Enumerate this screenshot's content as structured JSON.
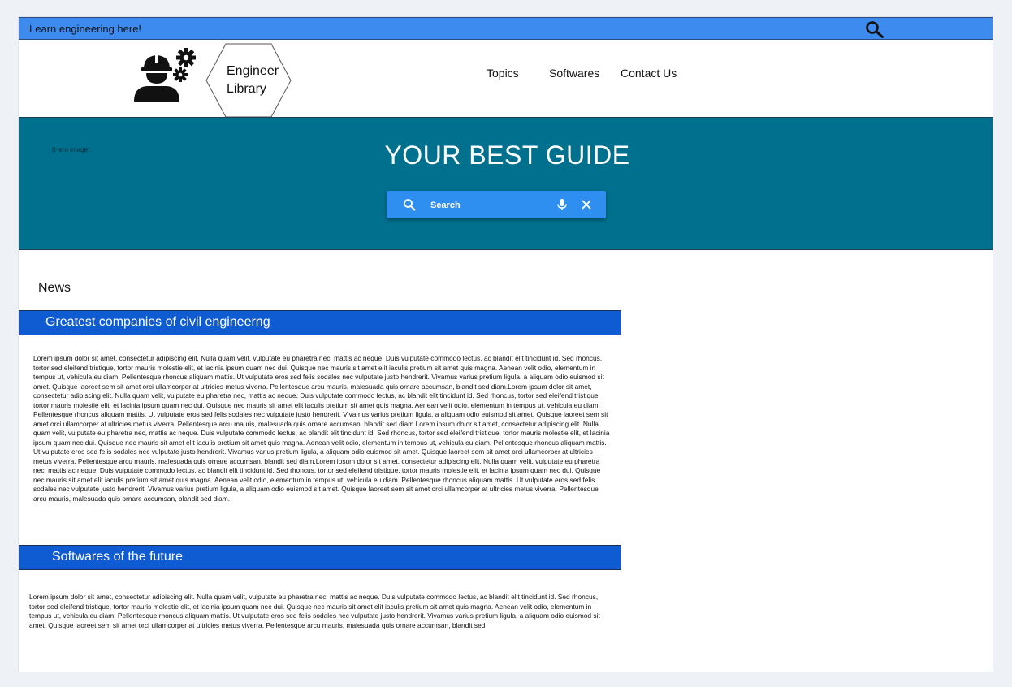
{
  "topbar": {
    "tagline": "Learn engineering here!",
    "search_icon": "search-icon",
    "color": "#3d8bef"
  },
  "header": {
    "logo_icon": "engineer-gears-icon",
    "logo_text_line1": "Engineer",
    "logo_text_line2": "Library",
    "nav": [
      {
        "label": "Topics"
      },
      {
        "label": "Softwares"
      },
      {
        "label": "Contact Us"
      }
    ]
  },
  "hero": {
    "label": "(Hero image)",
    "title": "YOUR BEST GUIDE",
    "color": "#00708f",
    "search": {
      "placeholder": "Search",
      "mic_icon": "mic-icon",
      "clear_icon": "close-icon"
    }
  },
  "news": {
    "title": "News",
    "sections": [
      {
        "heading": "Greatest companies of civil engineerng",
        "body": "Lorem ipsum dolor sit amet, consectetur adipiscing elit. Nulla quam velit, vulputate eu pharetra nec, mattis ac neque. Duis vulputate commodo lectus, ac blandit elit tincidunt id. Sed rhoncus, tortor sed eleifend tristique, tortor mauris molestie elit, et lacinia ipsum quam nec dui. Quisque nec mauris sit amet elit iaculis pretium sit amet quis magna. Aenean velit odio, elementum in tempus ut, vehicula eu diam. Pellentesque rhoncus aliquam mattis. Ut vulputate eros sed felis sodales nec vulputate justo hendrerit. Vivamus varius pretium ligula, a aliquam odio euismod sit amet. Quisque laoreet sem sit amet orci ullamcorper at ultricies metus viverra. Pellentesque arcu mauris, malesuada quis ornare accumsan, blandit sed diam.Lorem ipsum dolor sit amet, consectetur adipiscing elit. Nulla quam velit, vulputate eu pharetra nec, mattis ac neque. Duis vulputate commodo lectus, ac blandit elit tincidunt id. Sed rhoncus, tortor sed eleifend tristique, tortor mauris molestie elit, et lacinia ipsum quam nec dui. Quisque nec mauris sit amet elit iaculis pretium sit amet quis magna. Aenean velit odio, elementum in tempus ut, vehicula eu diam. Pellentesque rhoncus aliquam mattis. Ut vulputate eros sed felis sodales nec vulputate justo hendrerit. Vivamus varius pretium ligula, a aliquam odio euismod sit amet. Quisque laoreet sem sit amet orci ullamcorper at ultricies metus viverra. Pellentesque arcu mauris, malesuada quis ornare accumsan, blandit sed diam.Lorem ipsum dolor sit amet, consectetur adipiscing elit. Nulla quam velit, vulputate eu pharetra nec, mattis ac neque. Duis vulputate commodo lectus, ac blandit elit tincidunt id. Sed rhoncus, tortor sed eleifend tristique, tortor mauris molestie elit, et lacinia ipsum quam nec dui. Quisque nec mauris sit amet elit iaculis pretium sit amet quis magna. Aenean velit odio, elementum in tempus ut, vehicula eu diam. Pellentesque rhoncus aliquam mattis. Ut vulputate eros sed felis sodales nec vulputate justo hendrerit. Vivamus varius pretium ligula, a aliquam odio euismod sit amet. Quisque laoreet sem sit amet orci ullamcorper at ultricies metus viverra. Pellentesque arcu mauris, malesuada quis ornare accumsan, blandit sed diam.Lorem ipsum dolor sit amet, consectetur adipiscing elit. Nulla quam velit, vulputate eu pharetra nec, mattis ac neque. Duis vulputate commodo lectus, ac blandit elit tincidunt id. Sed rhoncus, tortor sed eleifend tristique, tortor mauris molestie elit, et lacinia ipsum quam nec dui. Quisque nec mauris sit amet elit iaculis pretium sit amet quis magna. Aenean velit odio, elementum in tempus ut, vehicula eu diam. Pellentesque rhoncus aliquam mattis. Ut vulputate eros sed felis sodales nec vulputate justo hendrerit. Vivamus varius pretium ligula, a aliquam odio euismod sit amet. Quisque laoreet sem sit amet orci ullamcorper at ultricies metus viverra. Pellentesque arcu mauris, malesuada quis ornare accumsan, blandit sed diam."
      },
      {
        "heading": "Softwares of the future",
        "body": "Lorem ipsum dolor sit amet, consectetur adipiscing elit. Nulla quam velit, vulputate eu pharetra nec, mattis ac neque. Duis vulputate commodo lectus, ac blandit elit tincidunt id. Sed rhoncus, tortor sed eleifend tristique, tortor mauris molestie elit, et lacinia ipsum quam nec dui. Quisque nec mauris sit amet elit iaculis pretium sit amet quis magna. Aenean velit odio, elementum in tempus ut, vehicula eu diam. Pellentesque rhoncus aliquam mattis. Ut vulputate eros sed felis sodales nec vulputate justo hendrerit. Vivamus varius pretium ligula, a aliquam odio euismod sit amet. Quisque laoreet sem sit amet orci ullamcorper at ultricies metus viverra. Pellentesque arcu mauris, malesuada quis ornare accumsan, blandit sed"
      }
    ],
    "section_color": "#0f5bd1"
  }
}
